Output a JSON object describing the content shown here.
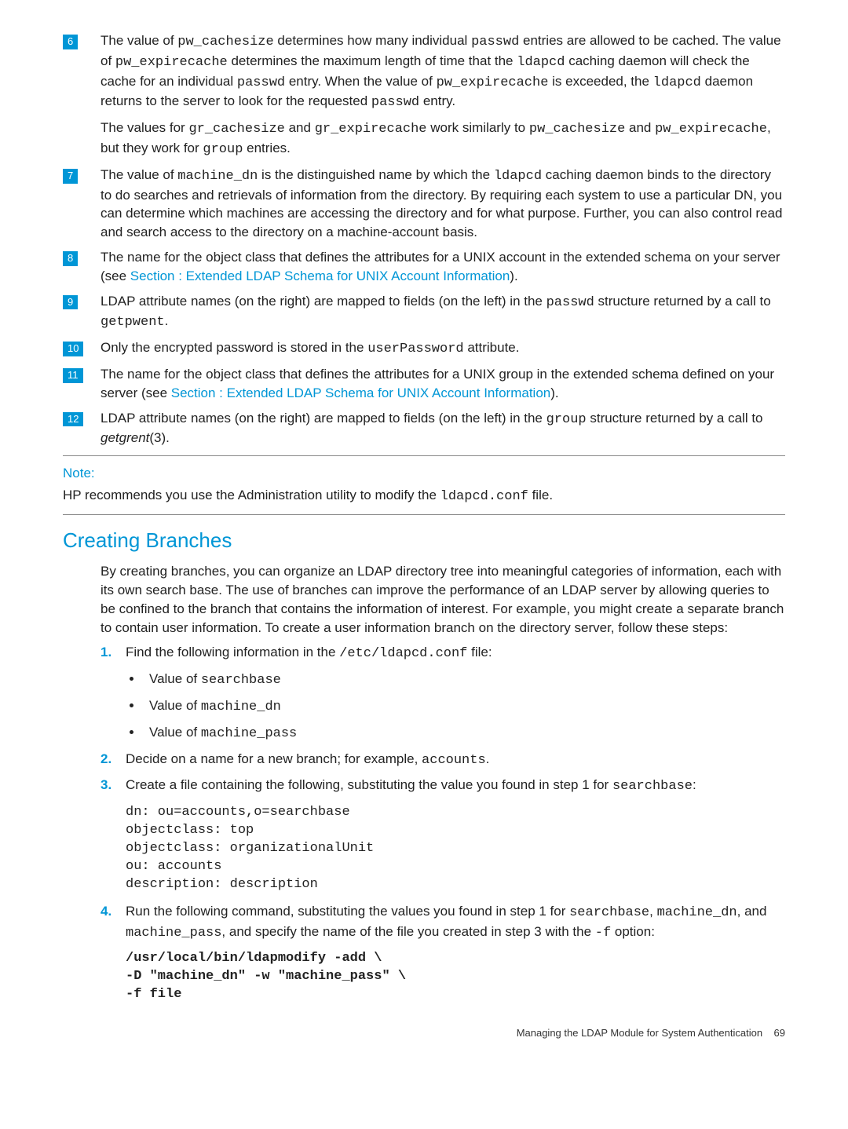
{
  "notes": {
    "n6": {
      "num": "6",
      "p1a": "The value of ",
      "p1b": "pw_cachesize",
      "p1c": " determines how many individual ",
      "p1d": "passwd",
      "p1e": " entries are allowed to be cached. The value of ",
      "p1f": "pw_expirecache",
      "p1g": " determines the maximum length of time that the ",
      "p1h": "ldapcd",
      "p1i": " caching daemon will check the cache for an individual ",
      "p1j": "passwd",
      "p1k": " entry. When the value of ",
      "p1l": "pw_expirecache",
      "p1m": " is exceeded, the ",
      "p1n": "ldapcd",
      "p1o": " daemon returns to the server to look for the requested ",
      "p1p": "passwd",
      "p1q": " entry.",
      "p2a": "The values for ",
      "p2b": "gr_cachesize",
      "p2c": " and ",
      "p2d": "gr_expirecache",
      "p2e": " work similarly to ",
      "p2f": "pw_cachesize",
      "p2g": " and ",
      "p2h": "pw_expirecache",
      "p2i": ", but they work for ",
      "p2j": "group",
      "p2k": " entries."
    },
    "n7": {
      "num": "7",
      "a": "The value of ",
      "b": "machine_dn",
      "c": " is the distinguished name by which the ",
      "d": "ldapcd",
      "e": " caching daemon binds to the directory to do searches and retrievals of information from the directory. By requiring each system to use a particular DN, you can determine which machines are accessing the directory and for what purpose. Further, you can also control read and search access to the directory on a machine-account basis."
    },
    "n8": {
      "num": "8",
      "a": "The name for the object class that defines the attributes for a UNIX account in the extended schema on your server (see ",
      "b": "Section : Extended LDAP Schema for UNIX Account Information",
      "c": ")."
    },
    "n9": {
      "num": "9",
      "a": "LDAP attribute names (on the right) are mapped to fields (on the left) in the ",
      "b": "passwd",
      "c": " structure returned by a call to ",
      "d": "getpwent",
      "e": "."
    },
    "n10": {
      "num": "10",
      "a": "Only the encrypted password is stored in the ",
      "b": "userPassword",
      "c": " attribute."
    },
    "n11": {
      "num": "11",
      "a": "The name for the object class that defines the attributes for a UNIX group in the extended schema defined on your server (see ",
      "b": "Section : Extended LDAP Schema for UNIX Account Information",
      "c": ")."
    },
    "n12": {
      "num": "12",
      "a": "LDAP attribute names (on the right) are mapped to fields (on the left) in the ",
      "b": "group",
      "c": " structure returned by a call to ",
      "d": "getgrent",
      "e": "(3)."
    }
  },
  "notebox": {
    "label": "Note:",
    "a": "HP recommends you use the Administration utility to modify the ",
    "b": "ldapcd.conf",
    "c": " file."
  },
  "heading": "Creating Branches",
  "intro": "By creating branches, you can organize an LDAP directory tree into meaningful categories of information, each with its own search base. The use of branches can improve the performance of an LDAP server by allowing queries to be confined to the branch that contains the information of interest. For example, you might create a separate branch to contain user information. To create a user information branch on the directory server, follow these steps:",
  "steps": {
    "s1": {
      "num": "1.",
      "a": "Find the following information in the ",
      "b": "/etc/ldapcd.conf",
      "c": " file:"
    },
    "b1": {
      "a": "Value of ",
      "b": "searchbase"
    },
    "b2": {
      "a": "Value of ",
      "b": "machine_dn"
    },
    "b3": {
      "a": "Value of ",
      "b": "machine_pass"
    },
    "s2": {
      "num": "2.",
      "a": "Decide on a name for a new branch; for example, ",
      "b": "accounts",
      "c": "."
    },
    "s3": {
      "num": "3.",
      "a": "Create a file containing the following, substituting the value you found in step 1 for ",
      "b": "searchbase",
      "c": ":"
    },
    "code1": "dn: ou=accounts,o=searchbase\nobjectclass: top\nobjectclass: organizationalUnit\nou: accounts\ndescription: description",
    "s4": {
      "num": "4.",
      "a": "Run the following command, substituting the values you found in step 1 for ",
      "b": "searchbase",
      "c": ", ",
      "d": "machine_dn",
      "e": ", and ",
      "f": "machine_pass",
      "g": ", and specify the name of the file you created in step 3 with the ",
      "h": "-f",
      "i": " option:"
    },
    "code2": "/usr/local/bin/ldapmodify -add \\\n-D \"machine_dn\" -w \"machine_pass\" \\\n-f file"
  },
  "footer": {
    "a": "Managing the LDAP Module for System Authentication",
    "b": "69"
  }
}
